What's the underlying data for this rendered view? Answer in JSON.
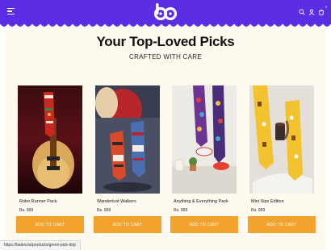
{
  "header": {
    "brand_color": "#5b2ee6",
    "menu_icon": "hamburger-menu-icon",
    "logo_text": "bo",
    "icons": [
      "search-icon",
      "user-icon",
      "cart-icon"
    ],
    "cart_count": "0"
  },
  "section": {
    "title": "Your Top-Loved Picks",
    "subtitle": "CRAFTED WITH CARE"
  },
  "products": [
    {
      "name": "Robo Runner Pack",
      "price": "Rs. 999",
      "button": "ADD TO CART"
    },
    {
      "name": "Wanderlust Walkers",
      "price": "Rs. 999",
      "button": "ADD TO CART"
    },
    {
      "name": "Anything & Everything Pack",
      "price": "Rs. 999",
      "button": "ADD TO CART"
    },
    {
      "name": "Mini Sips Edition",
      "price": "Rs. 999",
      "button": "ADD TO CART"
    }
  ],
  "button_color": "#f2a32d",
  "status_bar": {
    "url": "https://balenzia/products/green-pick-drip"
  }
}
